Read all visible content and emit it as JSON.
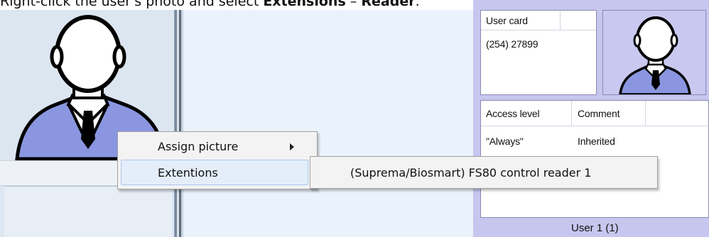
{
  "instruction": {
    "prefix": "Right-click the user's photo and select ",
    "extensions": "Extensions",
    "separator": " – ",
    "reader": "Reader",
    "suffix": "."
  },
  "user_card": {
    "header": "User card",
    "value": "(254) 27899"
  },
  "access_table": {
    "columns": [
      "Access level",
      "Comment"
    ],
    "rows": [
      {
        "access_level": "\"Always\"",
        "comment": "Inherited"
      }
    ]
  },
  "footer": {
    "user_label": "User 1 (1)"
  },
  "context_menu": {
    "items": [
      {
        "label": "Assign picture",
        "has_submenu": true
      },
      {
        "label": "Extentions",
        "highlighted": true
      }
    ]
  },
  "submenu": {
    "items": [
      {
        "label": "(Suprema/Biosmart) FS80 control reader 1"
      }
    ]
  },
  "colors": {
    "avatar_shirt": "#8a97e0",
    "avatar_outline": "#000000",
    "panel_lavender": "#c7c6ee",
    "menu_highlight": "#e4eefa"
  },
  "icons": [
    "user-avatar-icon",
    "submenu-arrow-icon"
  ]
}
